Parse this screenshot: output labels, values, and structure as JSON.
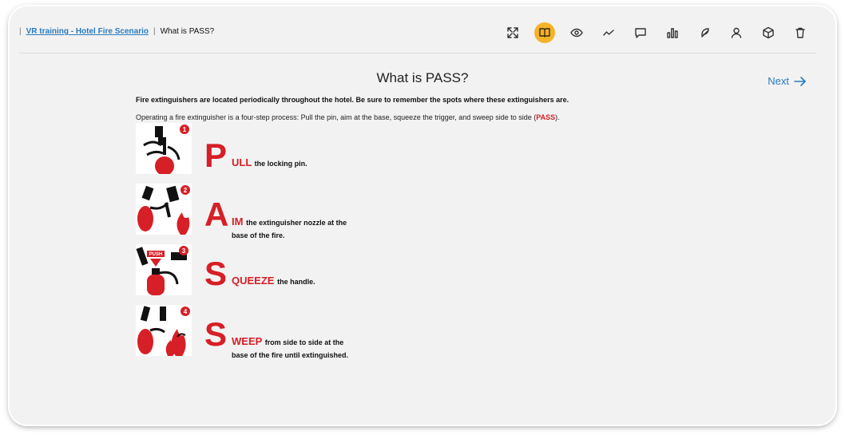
{
  "breadcrumb": {
    "separator": "|",
    "link": "VR training - Hotel Fire Scenario",
    "current": "What is PASS?"
  },
  "toolbar": {
    "icons": [
      "expand-icon",
      "book-icon",
      "eye-icon",
      "trend-icon",
      "comment-icon",
      "chart-icon",
      "feather-icon",
      "user-icon",
      "cube-icon",
      "trash-icon"
    ],
    "active": "book-icon",
    "accent": "#f5b32a"
  },
  "page": {
    "title": "What is PASS?",
    "next_label": "Next",
    "intro_bold": "Fire extinguishers are located periodically throughout the hotel. Be sure to remember the spots where these extinguishers are.",
    "intro_text": "Operating a fire extinguisher is a four-step process: Pull the pin, aim at the base, squeeze the trigger, and sweep side to side (",
    "intro_pass": "PASS",
    "intro_end": ")."
  },
  "steps": [
    {
      "num": "1",
      "letter": "P",
      "rest": "ULL",
      "line1": "the locking pin.",
      "line2": ""
    },
    {
      "num": "2",
      "letter": "A",
      "rest": "IM",
      "line1": "the extinguisher nozzle at the",
      "line2": "base of the fire."
    },
    {
      "num": "3",
      "letter": "S",
      "rest": "QUEEZE",
      "line1": "the handle.",
      "line2": "",
      "push_label": "PUSH"
    },
    {
      "num": "4",
      "letter": "S",
      "rest": "WEEP",
      "line1": "from side to side at the",
      "line2": "base of the fire until extinguished."
    }
  ],
  "colors": {
    "red": "#d61f26",
    "link": "#2a7bbf"
  }
}
